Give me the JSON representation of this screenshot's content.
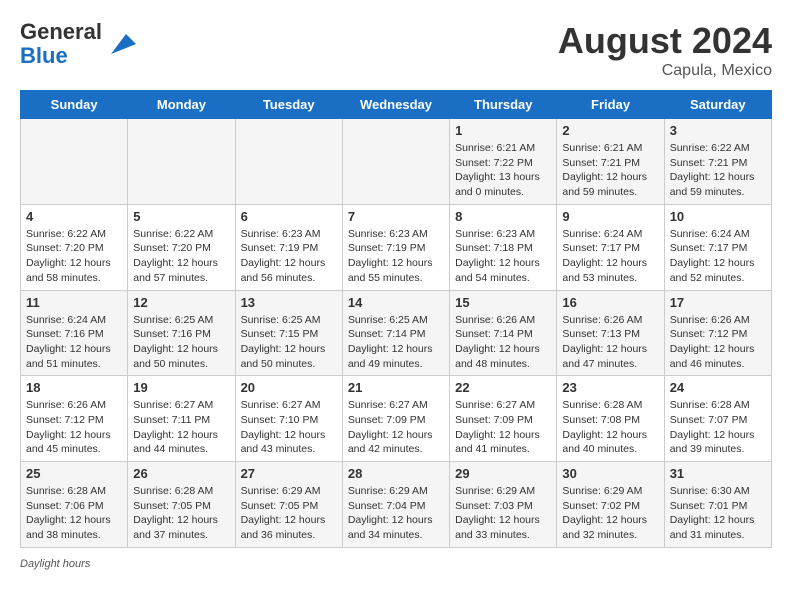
{
  "header": {
    "logo_general": "General",
    "logo_blue": "Blue",
    "month_year": "August 2024",
    "location": "Capula, Mexico"
  },
  "days_of_week": [
    "Sunday",
    "Monday",
    "Tuesday",
    "Wednesday",
    "Thursday",
    "Friday",
    "Saturday"
  ],
  "weeks": [
    [
      {
        "day": "",
        "info": ""
      },
      {
        "day": "",
        "info": ""
      },
      {
        "day": "",
        "info": ""
      },
      {
        "day": "",
        "info": ""
      },
      {
        "day": "1",
        "info": "Sunrise: 6:21 AM\nSunset: 7:22 PM\nDaylight: 13 hours and 0 minutes."
      },
      {
        "day": "2",
        "info": "Sunrise: 6:21 AM\nSunset: 7:21 PM\nDaylight: 12 hours and 59 minutes."
      },
      {
        "day": "3",
        "info": "Sunrise: 6:22 AM\nSunset: 7:21 PM\nDaylight: 12 hours and 59 minutes."
      }
    ],
    [
      {
        "day": "4",
        "info": "Sunrise: 6:22 AM\nSunset: 7:20 PM\nDaylight: 12 hours and 58 minutes."
      },
      {
        "day": "5",
        "info": "Sunrise: 6:22 AM\nSunset: 7:20 PM\nDaylight: 12 hours and 57 minutes."
      },
      {
        "day": "6",
        "info": "Sunrise: 6:23 AM\nSunset: 7:19 PM\nDaylight: 12 hours and 56 minutes."
      },
      {
        "day": "7",
        "info": "Sunrise: 6:23 AM\nSunset: 7:19 PM\nDaylight: 12 hours and 55 minutes."
      },
      {
        "day": "8",
        "info": "Sunrise: 6:23 AM\nSunset: 7:18 PM\nDaylight: 12 hours and 54 minutes."
      },
      {
        "day": "9",
        "info": "Sunrise: 6:24 AM\nSunset: 7:17 PM\nDaylight: 12 hours and 53 minutes."
      },
      {
        "day": "10",
        "info": "Sunrise: 6:24 AM\nSunset: 7:17 PM\nDaylight: 12 hours and 52 minutes."
      }
    ],
    [
      {
        "day": "11",
        "info": "Sunrise: 6:24 AM\nSunset: 7:16 PM\nDaylight: 12 hours and 51 minutes."
      },
      {
        "day": "12",
        "info": "Sunrise: 6:25 AM\nSunset: 7:16 PM\nDaylight: 12 hours and 50 minutes."
      },
      {
        "day": "13",
        "info": "Sunrise: 6:25 AM\nSunset: 7:15 PM\nDaylight: 12 hours and 50 minutes."
      },
      {
        "day": "14",
        "info": "Sunrise: 6:25 AM\nSunset: 7:14 PM\nDaylight: 12 hours and 49 minutes."
      },
      {
        "day": "15",
        "info": "Sunrise: 6:26 AM\nSunset: 7:14 PM\nDaylight: 12 hours and 48 minutes."
      },
      {
        "day": "16",
        "info": "Sunrise: 6:26 AM\nSunset: 7:13 PM\nDaylight: 12 hours and 47 minutes."
      },
      {
        "day": "17",
        "info": "Sunrise: 6:26 AM\nSunset: 7:12 PM\nDaylight: 12 hours and 46 minutes."
      }
    ],
    [
      {
        "day": "18",
        "info": "Sunrise: 6:26 AM\nSunset: 7:12 PM\nDaylight: 12 hours and 45 minutes."
      },
      {
        "day": "19",
        "info": "Sunrise: 6:27 AM\nSunset: 7:11 PM\nDaylight: 12 hours and 44 minutes."
      },
      {
        "day": "20",
        "info": "Sunrise: 6:27 AM\nSunset: 7:10 PM\nDaylight: 12 hours and 43 minutes."
      },
      {
        "day": "21",
        "info": "Sunrise: 6:27 AM\nSunset: 7:09 PM\nDaylight: 12 hours and 42 minutes."
      },
      {
        "day": "22",
        "info": "Sunrise: 6:27 AM\nSunset: 7:09 PM\nDaylight: 12 hours and 41 minutes."
      },
      {
        "day": "23",
        "info": "Sunrise: 6:28 AM\nSunset: 7:08 PM\nDaylight: 12 hours and 40 minutes."
      },
      {
        "day": "24",
        "info": "Sunrise: 6:28 AM\nSunset: 7:07 PM\nDaylight: 12 hours and 39 minutes."
      }
    ],
    [
      {
        "day": "25",
        "info": "Sunrise: 6:28 AM\nSunset: 7:06 PM\nDaylight: 12 hours and 38 minutes."
      },
      {
        "day": "26",
        "info": "Sunrise: 6:28 AM\nSunset: 7:05 PM\nDaylight: 12 hours and 37 minutes."
      },
      {
        "day": "27",
        "info": "Sunrise: 6:29 AM\nSunset: 7:05 PM\nDaylight: 12 hours and 36 minutes."
      },
      {
        "day": "28",
        "info": "Sunrise: 6:29 AM\nSunset: 7:04 PM\nDaylight: 12 hours and 34 minutes."
      },
      {
        "day": "29",
        "info": "Sunrise: 6:29 AM\nSunset: 7:03 PM\nDaylight: 12 hours and 33 minutes."
      },
      {
        "day": "30",
        "info": "Sunrise: 6:29 AM\nSunset: 7:02 PM\nDaylight: 12 hours and 32 minutes."
      },
      {
        "day": "31",
        "info": "Sunrise: 6:30 AM\nSunset: 7:01 PM\nDaylight: 12 hours and 31 minutes."
      }
    ]
  ],
  "footer": {
    "note": "Daylight hours"
  }
}
